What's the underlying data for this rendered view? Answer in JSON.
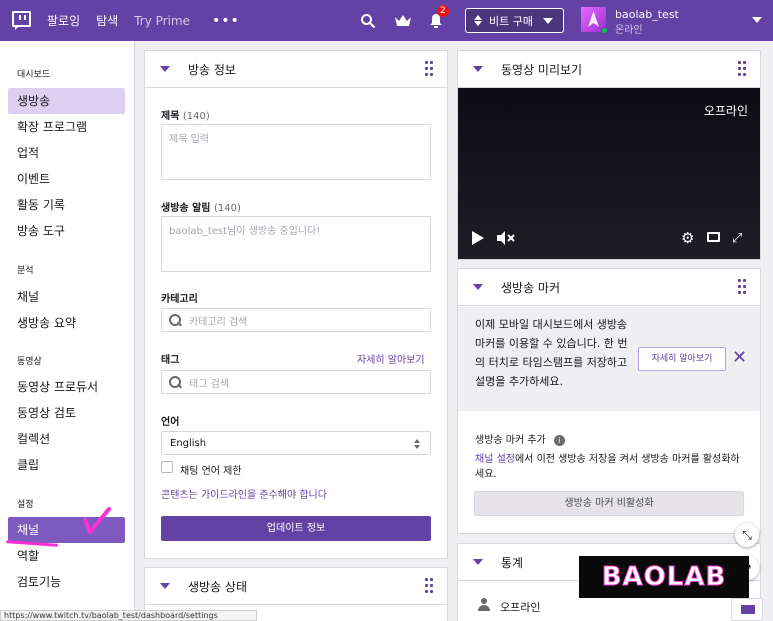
{
  "colors": {
    "brand": "#6441a4",
    "accent_pink": "#ff2fd3",
    "badge_red": "#ec1313"
  },
  "topbar": {
    "nav": [
      "팔로잉",
      "탐색",
      "Try Prime"
    ],
    "more": "•••",
    "notification_count": "2",
    "bits_label": "비트 구매",
    "user_name": "baolab_test",
    "user_status": "온라인",
    "icons": [
      "twitch-logo-icon",
      "search-icon",
      "crown-icon",
      "bell-icon",
      "bits-gem-icon",
      "chevron-down-icon"
    ]
  },
  "sidebar": {
    "sections": [
      {
        "heading": "대시보드",
        "items": [
          "생방송",
          "확장 프로그램",
          "업적",
          "이벤트",
          "활동 기록",
          "방송 도구"
        ]
      },
      {
        "heading": "분석",
        "items": [
          "채널",
          "생방송 요약"
        ]
      },
      {
        "heading": "동영상",
        "items": [
          "동영상 프로듀서",
          "동영상 검토",
          "컬렉션",
          "클립"
        ]
      },
      {
        "heading": "설정",
        "items": [
          "채널",
          "역할",
          "검토기능"
        ]
      }
    ]
  },
  "stream_info": {
    "title": "방송 정보",
    "title_label": "제목",
    "title_count": "(140)",
    "title_placeholder": "제목 입력",
    "notify_label": "생방송 알림",
    "notify_count": "(140)",
    "notify_placeholder": "baolab_test님이 생방송 중입니다!",
    "category_label": "카테고리",
    "category_placeholder": "카테고리 검색",
    "tags_label": "태그",
    "tags_learn_more": "자세히 알아보기",
    "tags_placeholder": "태그 검색",
    "language_label": "언어",
    "language_value": "English",
    "chat_language_restrict": "채팅 언어 제한",
    "guidelines_link": "콘텐츠는 가이드라인을 준수해야 합니다",
    "update_button": "업데이트 정보"
  },
  "stream_status": {
    "title": "생방송 상태"
  },
  "preview": {
    "title": "동영상 미리보기",
    "offline_label": "오프라인"
  },
  "markers": {
    "title": "생방송 마커",
    "banner_text": "이제 모바일 대시보드에서 생방송 마커를 이용할 수 있습니다. 한 번의 터치로 타임스탬프를 저장하고 설명을 추가하세요.",
    "learn_more": "자세히 알아보기",
    "add_label": "생방송 마커 추가",
    "info_glyph": "i",
    "help_link": "채널 설정",
    "help_text": "에서 이전 생방송 저장을 켜서 생방송 마커를 활성화하세요.",
    "disabled_button": "생방송 마커 비활성화"
  },
  "stats": {
    "title": "통계",
    "status": "오프라인"
  },
  "watermark": "BAOLAB",
  "statusbar_url": "https://www.twitch.tv/baolab_test/dashboard/settings"
}
